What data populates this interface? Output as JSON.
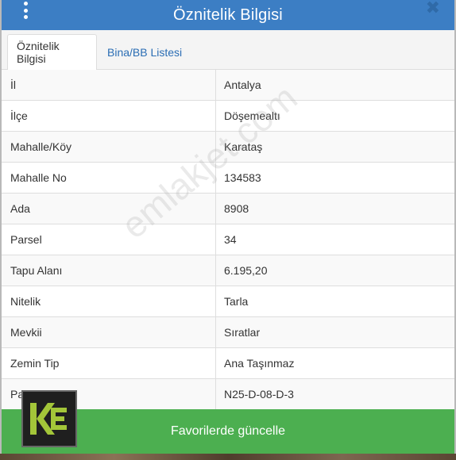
{
  "header": {
    "title": "Öznitelik Bilgisi",
    "close_glyph": "✖"
  },
  "tabs": [
    {
      "label": "Öznitelik Bilgisi",
      "active": true
    },
    {
      "label": "Bina/BB Listesi",
      "active": false
    }
  ],
  "rows": [
    {
      "label": "İl",
      "value": "Antalya"
    },
    {
      "label": "İlçe",
      "value": "Döşemealtı"
    },
    {
      "label": "Mahalle/Köy",
      "value": "Karataş"
    },
    {
      "label": "Mahalle No",
      "value": "134583"
    },
    {
      "label": "Ada",
      "value": "8908"
    },
    {
      "label": "Parsel",
      "value": "34"
    },
    {
      "label": "Tapu Alanı",
      "value": "6.195,20"
    },
    {
      "label": "Nitelik",
      "value": "Tarla"
    },
    {
      "label": "Mevkii",
      "value": "Sıratlar"
    },
    {
      "label": "Zemin Tip",
      "value": "Ana Taşınmaz"
    },
    {
      "label": "Pafta",
      "value": "N25-D-08-D-3"
    }
  ],
  "watermark": "emlakjet.com",
  "footer": {
    "button_label": "Favorilerde güncelle"
  },
  "logo": {
    "text": "KE"
  },
  "colors": {
    "header": "#3c7ec4",
    "tab_link": "#2a6db4",
    "footer_button": "#4caf50",
    "logo_green": "#a3c639"
  },
  "icons": {
    "menu": "vertical-dots-icon",
    "close": "close-icon"
  }
}
